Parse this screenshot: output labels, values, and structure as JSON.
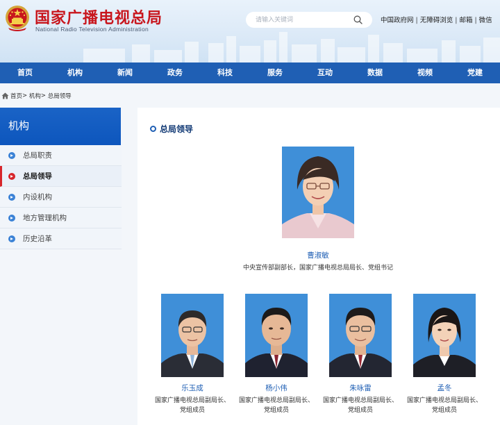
{
  "header": {
    "title": "国家广播电视总局",
    "subtitle": "National Radio Television Administration",
    "search": {
      "placeholder": "请输入关键词"
    },
    "links": [
      "中国政府网",
      "无障碍浏览",
      "邮箱",
      "微信"
    ]
  },
  "nav": [
    "首页",
    "机构",
    "新闻",
    "政务",
    "科技",
    "服务",
    "互动",
    "数据",
    "视频",
    "党建"
  ],
  "breadcrumb": [
    "首页",
    "机构",
    "总局领导"
  ],
  "sidebar": {
    "heading": "机构",
    "items": [
      "总局职责",
      "总局领导",
      "内设机构",
      "地方管理机构",
      "历史沿革"
    ],
    "active_index": 1
  },
  "main": {
    "section_title": "总局领导",
    "chief": {
      "name": "曹淑敏",
      "title": "中央宣传部副部长，国家广播电视总局局长、党组书记"
    },
    "deputies": [
      {
        "name": "乐玉成",
        "title_line1": "国家广播电视总局副局长、",
        "title_line2": "党组成员"
      },
      {
        "name": "杨小伟",
        "title_line1": "国家广播电视总局副局长、",
        "title_line2": "党组成员"
      },
      {
        "name": "朱咏雷",
        "title_line1": "国家广播电视总局副局长、",
        "title_line2": "党组成员"
      },
      {
        "name": "孟冬",
        "title_line1": "国家广播电视总局副局长、",
        "title_line2": "党组成员"
      }
    ]
  },
  "colors": {
    "brand_red": "#c8161d",
    "nav_blue": "#1f5fb4",
    "side_head_blue": "#0d56bd",
    "active_red": "#d7262b",
    "photo_bg_blue": "#3f8fd8"
  }
}
